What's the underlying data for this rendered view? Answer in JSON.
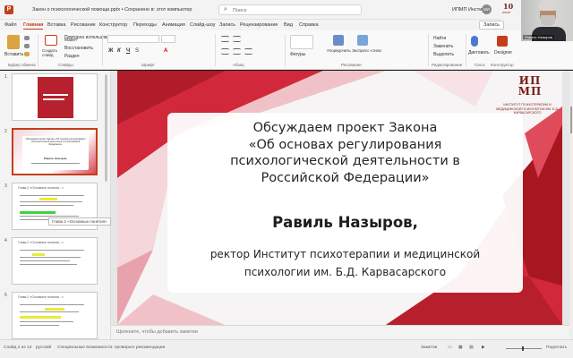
{
  "window": {
    "app_initial": "P",
    "doc_title": "Закон о психологической помощи.pptx • Сохранено в: этот компьютер",
    "search_placeholder": "Поиск",
    "user_name": "ИПМП Институт",
    "user_initials": "ИИ"
  },
  "tabs": [
    "Файл",
    "Главная",
    "Вставка",
    "Рисование",
    "Конструктор",
    "Переходы",
    "Анимация",
    "Слайд-шоу",
    "Запись",
    "Рецензирование",
    "Вид",
    "Справка"
  ],
  "tabs_active": "Главная",
  "comment_button": "Запись",
  "ribbon": {
    "paste": "Вставить",
    "layout": "Макет",
    "reset": "Восстановить",
    "section": "Раздел",
    "new_slide": "Создать слайд",
    "reuse": "Повторно использовать слайды",
    "shapes": "Фигуры",
    "arrange": "Упорядочить",
    "styles": "Экспресс-стили",
    "find": "Найти",
    "replace": "Заменить",
    "select": "Выделить",
    "dictate": "Диктовать",
    "designer": "Designer",
    "groups": {
      "clipboard": "Буфер обмена",
      "slides": "Слайды",
      "font": "Шрифт",
      "paragraph": "Абзац",
      "drawing": "Рисование",
      "editing": "Редактирование",
      "voice": "Голос",
      "designer": "Конструктор"
    }
  },
  "thumbnails": {
    "numbers": [
      "1",
      "2",
      "3",
      "4",
      "5"
    ],
    "slide2_heading": "Обсуждаем проект Закона «Об основах регулирования психологической деятельности в Российской Федерации»",
    "slide2_speaker": "Равиль Назыров,",
    "slide3_title": "Глава 2 «Основные понятия...»",
    "slide4_title": "Глава 2 «Основные понятия...»",
    "slide5_title": "Глава 2 «Основные понятия...»",
    "tooltip": "Глава 2 «Основные понятия»"
  },
  "slide": {
    "title_lines": [
      "Обсуждаем проект Закона",
      "«Об основах регулирования",
      "психологической деятельности в",
      "Российской Федерации»"
    ],
    "speaker": "Равиль Назыров,",
    "role_lines": [
      "ректор Институт психотерапии и медицинской",
      "психологии им. Б.Д. Карвасарского"
    ],
    "logo_letters_top": "ИП",
    "logo_letters_bottom": "МП",
    "logo_text": "Институт психотерапии и медицинской психологии им. Б.Д. Карвасарского"
  },
  "notes_placeholder": "Щелкните, чтобы добавить заметки",
  "status": {
    "slide_counter": "Слайд 2 из 13",
    "language": "русский",
    "accessibility": "Специальные возможности: проверьте рекомендации",
    "notes": "Заметки",
    "zoom": "Подогнать"
  },
  "webcam": {
    "name_tag": "Равиль Назыров"
  },
  "corner_logo": {
    "top": "10",
    "bottom": "ИПМП"
  },
  "colors": {
    "accent": "#c43e1c",
    "slide_red": "#d2283b",
    "slide_dark_red": "#a8161f",
    "slide_pink": "#f0c2c8"
  }
}
